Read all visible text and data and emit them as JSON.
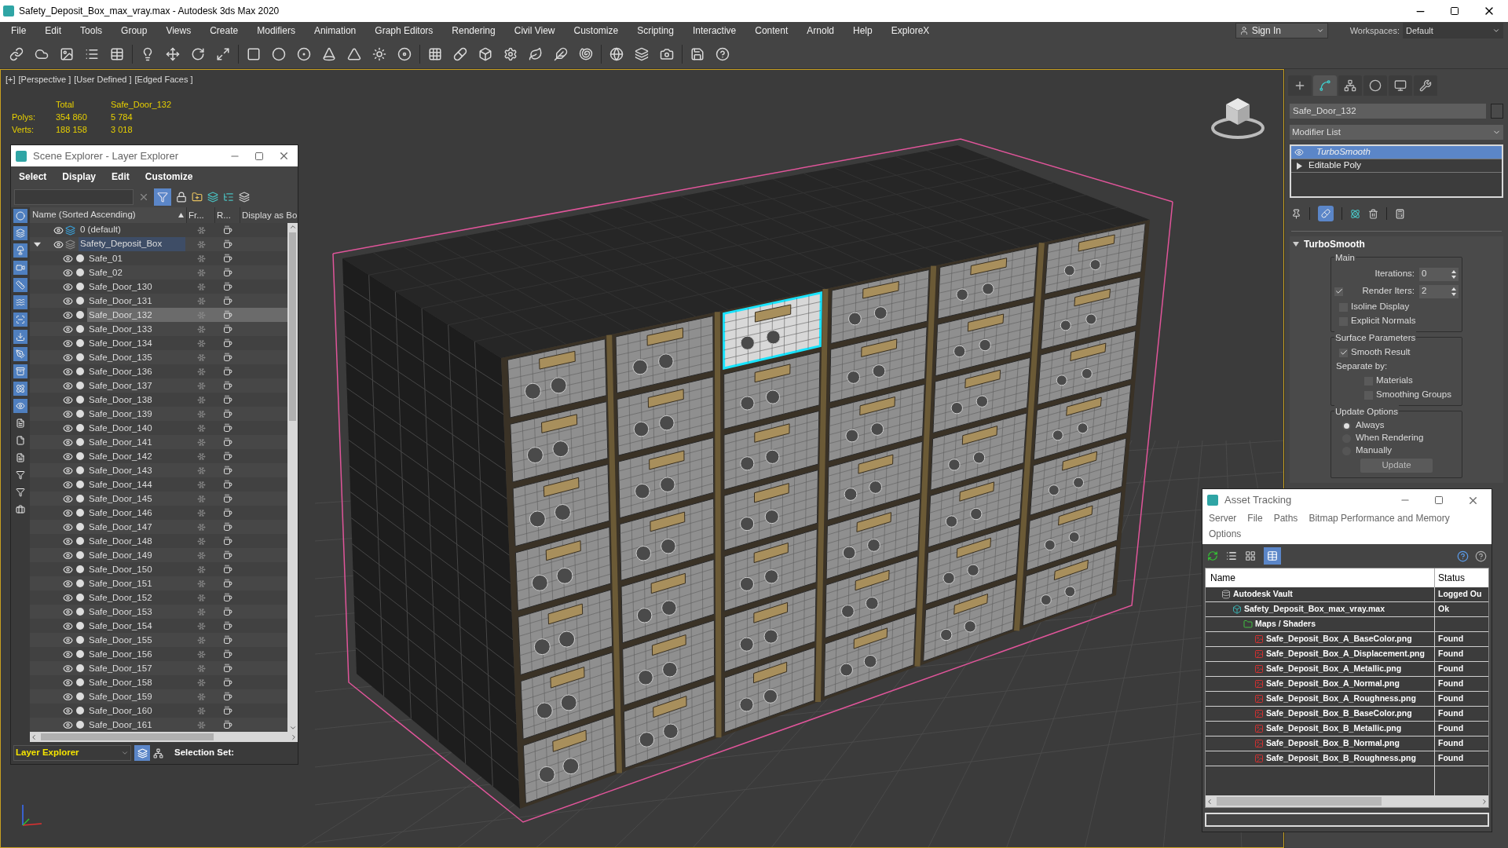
{
  "window": {
    "title": "Safety_Deposit_Box_max_vray.max - Autodesk 3ds Max 2020"
  },
  "menu": [
    "File",
    "Edit",
    "Tools",
    "Group",
    "Views",
    "Create",
    "Modifiers",
    "Animation",
    "Graph Editors",
    "Rendering",
    "Civil View",
    "Customize",
    "Scripting",
    "Interactive",
    "Content",
    "Arnold",
    "Help",
    "ExploreX"
  ],
  "sign_in": "Sign In",
  "workspaces": {
    "label": "Workspaces:",
    "value": "Default"
  },
  "viewport": {
    "labels": [
      "[+]",
      "[Perspective ]",
      "[User Defined ]",
      "[Edged Faces ]"
    ],
    "stats": {
      "headers": [
        "Total",
        "Safe_Door_132"
      ],
      "rows": [
        {
          "label": "Polys:",
          "values": [
            "354 860",
            "5 784"
          ]
        },
        {
          "label": "Verts:",
          "values": [
            "188 158",
            "3 018"
          ]
        }
      ]
    }
  },
  "scene_explorer": {
    "title": "Scene Explorer - Layer Explorer",
    "menu": [
      "Select",
      "Display",
      "Edit",
      "Customize"
    ],
    "columns": [
      "Name (Sorted Ascending)",
      "Fr...",
      "R...",
      "Display as Bo"
    ],
    "layers": [
      {
        "name": "0 (default)",
        "current": false
      },
      {
        "name": "Safety_Deposit_Box",
        "current": true,
        "expanded": true,
        "children": [
          {
            "name": "Safe_01",
            "selected": false
          },
          {
            "name": "Safe_02",
            "selected": false
          },
          {
            "name": "Safe_Door_130",
            "selected": false
          },
          {
            "name": "Safe_Door_131",
            "selected": false
          },
          {
            "name": "Safe_Door_132",
            "selected": true
          },
          {
            "name": "Safe_Door_133",
            "selected": false
          },
          {
            "name": "Safe_Door_134",
            "selected": false
          },
          {
            "name": "Safe_Door_135",
            "selected": false
          },
          {
            "name": "Safe_Door_136",
            "selected": false
          },
          {
            "name": "Safe_Door_137",
            "selected": false
          },
          {
            "name": "Safe_Door_138",
            "selected": false
          },
          {
            "name": "Safe_Door_139",
            "selected": false
          },
          {
            "name": "Safe_Door_140",
            "selected": false
          },
          {
            "name": "Safe_Door_141",
            "selected": false
          },
          {
            "name": "Safe_Door_142",
            "selected": false
          },
          {
            "name": "Safe_Door_143",
            "selected": false
          },
          {
            "name": "Safe_Door_144",
            "selected": false
          },
          {
            "name": "Safe_Door_145",
            "selected": false
          },
          {
            "name": "Safe_Door_146",
            "selected": false
          },
          {
            "name": "Safe_Door_147",
            "selected": false
          },
          {
            "name": "Safe_Door_148",
            "selected": false
          },
          {
            "name": "Safe_Door_149",
            "selected": false
          },
          {
            "name": "Safe_Door_150",
            "selected": false
          },
          {
            "name": "Safe_Door_151",
            "selected": false
          },
          {
            "name": "Safe_Door_152",
            "selected": false
          },
          {
            "name": "Safe_Door_153",
            "selected": false
          },
          {
            "name": "Safe_Door_154",
            "selected": false
          },
          {
            "name": "Safe_Door_155",
            "selected": false
          },
          {
            "name": "Safe_Door_156",
            "selected": false
          },
          {
            "name": "Safe_Door_157",
            "selected": false
          },
          {
            "name": "Safe_Door_158",
            "selected": false
          },
          {
            "name": "Safe_Door_159",
            "selected": false
          },
          {
            "name": "Safe_Door_160",
            "selected": false
          },
          {
            "name": "Safe_Door_161",
            "selected": false
          }
        ]
      }
    ],
    "footer": {
      "explorer": "Layer Explorer",
      "selection_set": "Selection Set:"
    }
  },
  "command_panel": {
    "tabs": [
      {
        "kind": "create",
        "selected": false
      },
      {
        "kind": "modify",
        "selected": true
      },
      {
        "kind": "hierarchy",
        "selected": false
      },
      {
        "kind": "motion",
        "selected": false
      },
      {
        "kind": "display",
        "selected": false
      },
      {
        "kind": "utilities",
        "selected": false
      }
    ],
    "object_name": "Safe_Door_132",
    "modifier_list": "Modifier List",
    "stack": [
      {
        "name": "TurboSmooth",
        "selected": true,
        "kind": "modifier"
      },
      {
        "name": "Editable Poly",
        "selected": false,
        "kind": "base"
      }
    ],
    "rollout": {
      "title": "TurboSmooth",
      "groups": [
        {
          "title": "Main",
          "items": [
            {
              "kind": "spinner",
              "label": "Iterations:",
              "value": "0"
            },
            {
              "kind": "spinner",
              "label": "Render Iters:",
              "value": "2",
              "checked": true
            },
            {
              "kind": "checkbox",
              "label": "Isoline Display",
              "checked": false
            },
            {
              "kind": "checkbox",
              "label": "Explicit Normals",
              "checked": false
            }
          ]
        },
        {
          "title": "Surface Parameters",
          "items": [
            {
              "kind": "checkbox",
              "label": "Smooth Result",
              "checked": true
            },
            {
              "kind": "label",
              "label": "Separate by:"
            },
            {
              "kind": "subcheckbox",
              "label": "Materials",
              "checked": false
            },
            {
              "kind": "subcheckbox",
              "label": "Smoothing Groups",
              "checked": false
            }
          ]
        },
        {
          "title": "Update Options",
          "items": [
            {
              "kind": "radio",
              "label": "Always",
              "selected": true
            },
            {
              "kind": "radio",
              "label": "When Rendering",
              "selected": false
            },
            {
              "kind": "radio",
              "label": "Manually",
              "selected": false
            },
            {
              "kind": "button",
              "label": "Update"
            }
          ]
        }
      ]
    }
  },
  "asset_tracking": {
    "title": "Asset Tracking",
    "menu": [
      "Server",
      "File",
      "Paths",
      "Bitmap Performance and Memory",
      "Options"
    ],
    "columns": [
      "Name",
      "Status"
    ],
    "rows": [
      {
        "kind": "vault",
        "name": "Autodesk Vault",
        "status": "Logged Ou",
        "children": [
          {
            "kind": "scene",
            "name": "Safety_Deposit_Box_max_vray.max",
            "status": "Ok",
            "children": [
              {
                "kind": "folder",
                "name": "Maps / Shaders",
                "children": [
                  {
                    "kind": "png",
                    "name": "Safe_Deposit_Box_A_BaseColor.png",
                    "status": "Found"
                  },
                  {
                    "kind": "png",
                    "name": "Safe_Deposit_Box_A_Displacement.png",
                    "status": "Found"
                  },
                  {
                    "kind": "png",
                    "name": "Safe_Deposit_Box_A_Metallic.png",
                    "status": "Found"
                  },
                  {
                    "kind": "png",
                    "name": "Safe_Deposit_Box_A_Normal.png",
                    "status": "Found"
                  },
                  {
                    "kind": "png",
                    "name": "Safe_Deposit_Box_A_Roughness.png",
                    "status": "Found"
                  },
                  {
                    "kind": "png",
                    "name": "Safe_Deposit_Box_B_BaseColor.png",
                    "status": "Found"
                  },
                  {
                    "kind": "png",
                    "name": "Safe_Deposit_Box_B_Metallic.png",
                    "status": "Found"
                  },
                  {
                    "kind": "png",
                    "name": "Safe_Deposit_Box_B_Normal.png",
                    "status": "Found"
                  },
                  {
                    "kind": "png",
                    "name": "Safe_Deposit_Box_B_Roughness.png",
                    "status": "Found"
                  }
                ]
              }
            ]
          }
        ]
      }
    ]
  }
}
